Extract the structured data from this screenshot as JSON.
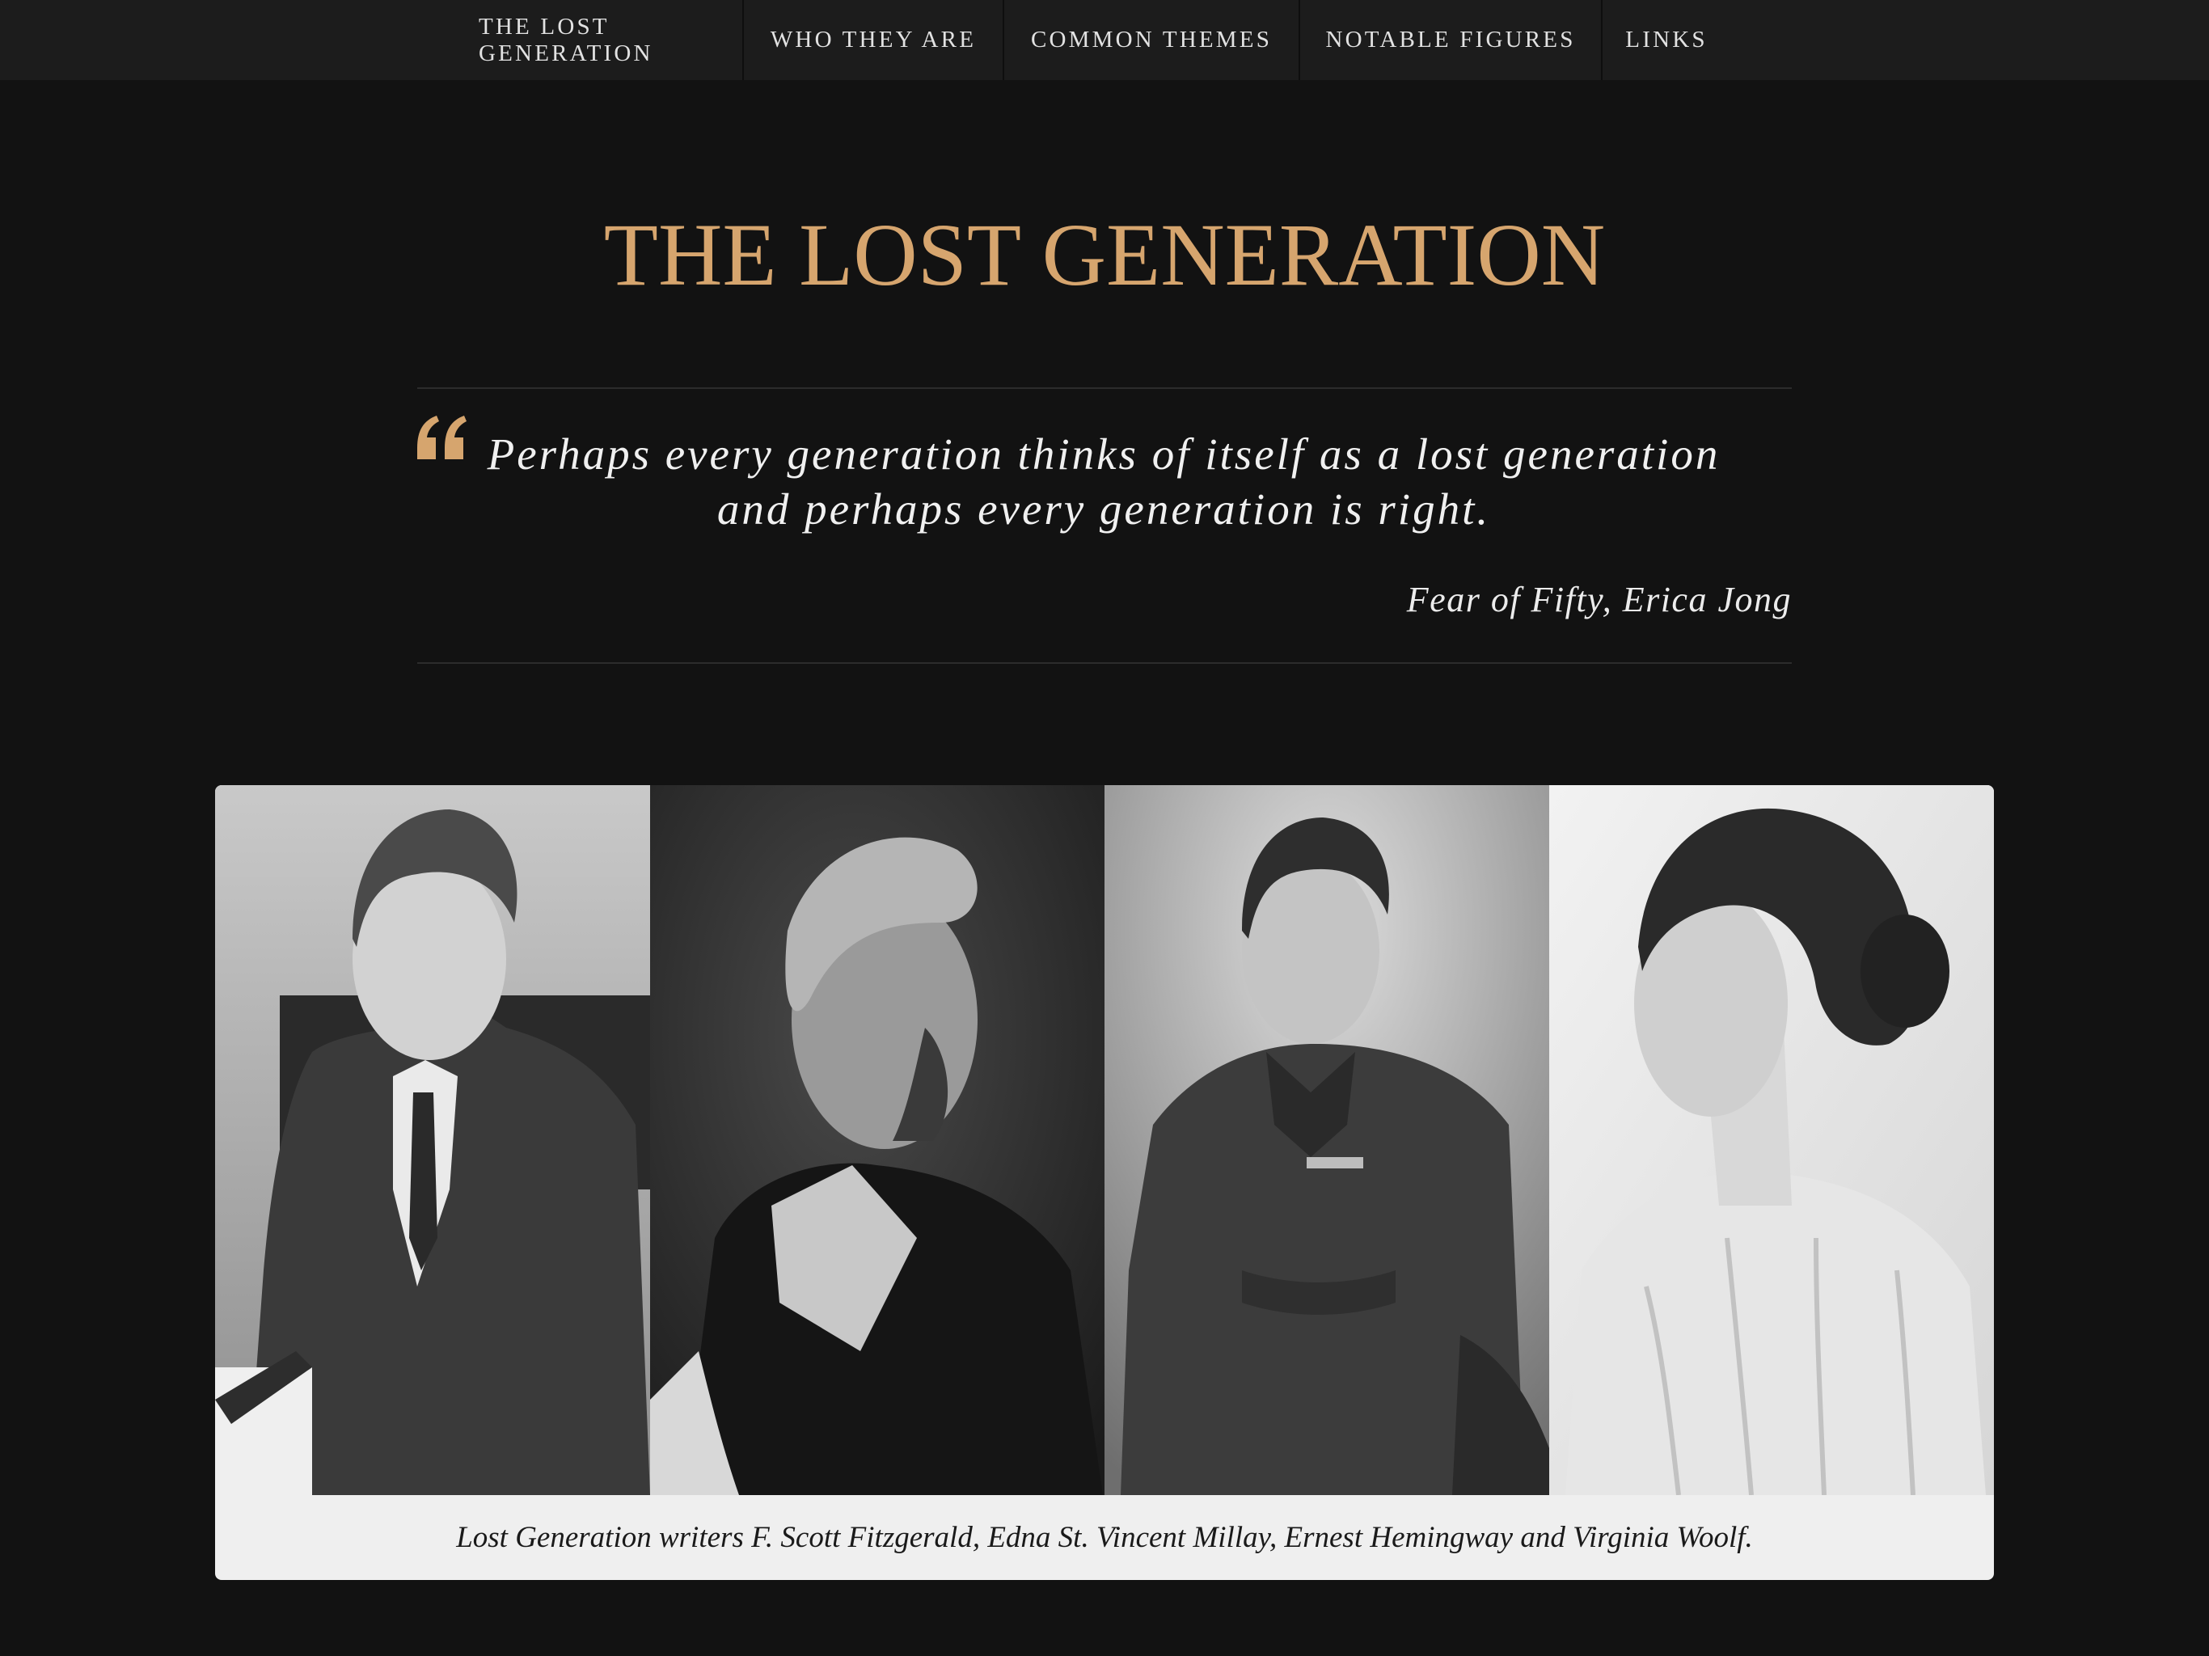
{
  "nav": {
    "items": [
      {
        "label": "THE LOST GENERATION"
      },
      {
        "label": "WHO THEY ARE"
      },
      {
        "label": "COMMON THEMES"
      },
      {
        "label": "NOTABLE FIGURES"
      },
      {
        "label": "LINKS"
      }
    ]
  },
  "header": {
    "title": "THE LOST GENERATION"
  },
  "quote": {
    "line1": "Perhaps every generation thinks of itself as a lost generation",
    "line2": "and perhaps every generation is right.",
    "source": "Fear of Fifty, Erica Jong"
  },
  "figure": {
    "caption": "Lost Generation writers F. Scott Fitzgerald, Edna St. Vincent Millay, Ernest Hemingway and Virginia Woolf."
  },
  "colors": {
    "accent": "#d6a56e",
    "background": "#121212",
    "nav_background": "#1c1c1c",
    "caption_background": "#efefef"
  },
  "icons": {
    "quote": "open-quote-icon"
  }
}
